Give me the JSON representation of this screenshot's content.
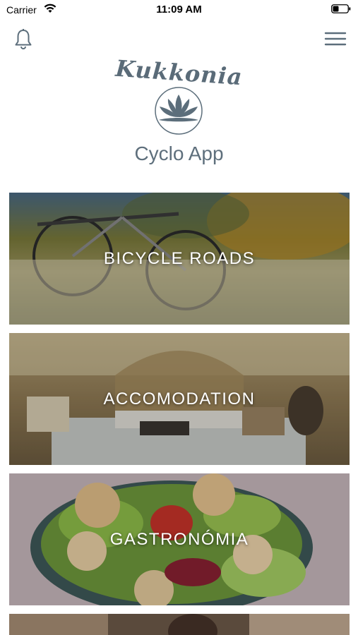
{
  "status_bar": {
    "carrier": "Carrier",
    "time": "11:09 AM",
    "wifi_icon": "wifi-icon",
    "battery_icon": "battery-icon"
  },
  "nav": {
    "left_icon": "bell-icon",
    "right_icon": "hamburger-menu-icon"
  },
  "logo": {
    "script_text": "Kukkonia",
    "emblem_icon": "lotus-icon"
  },
  "app_title": "Cyclo App",
  "cards": [
    {
      "label": "BICYCLE ROADS"
    },
    {
      "label": "ACCOMODATION"
    },
    {
      "label": "GASTRONÓMIA"
    }
  ],
  "colors": {
    "brand_slate": "#5c6e7b",
    "card_text": "#ffffff"
  }
}
